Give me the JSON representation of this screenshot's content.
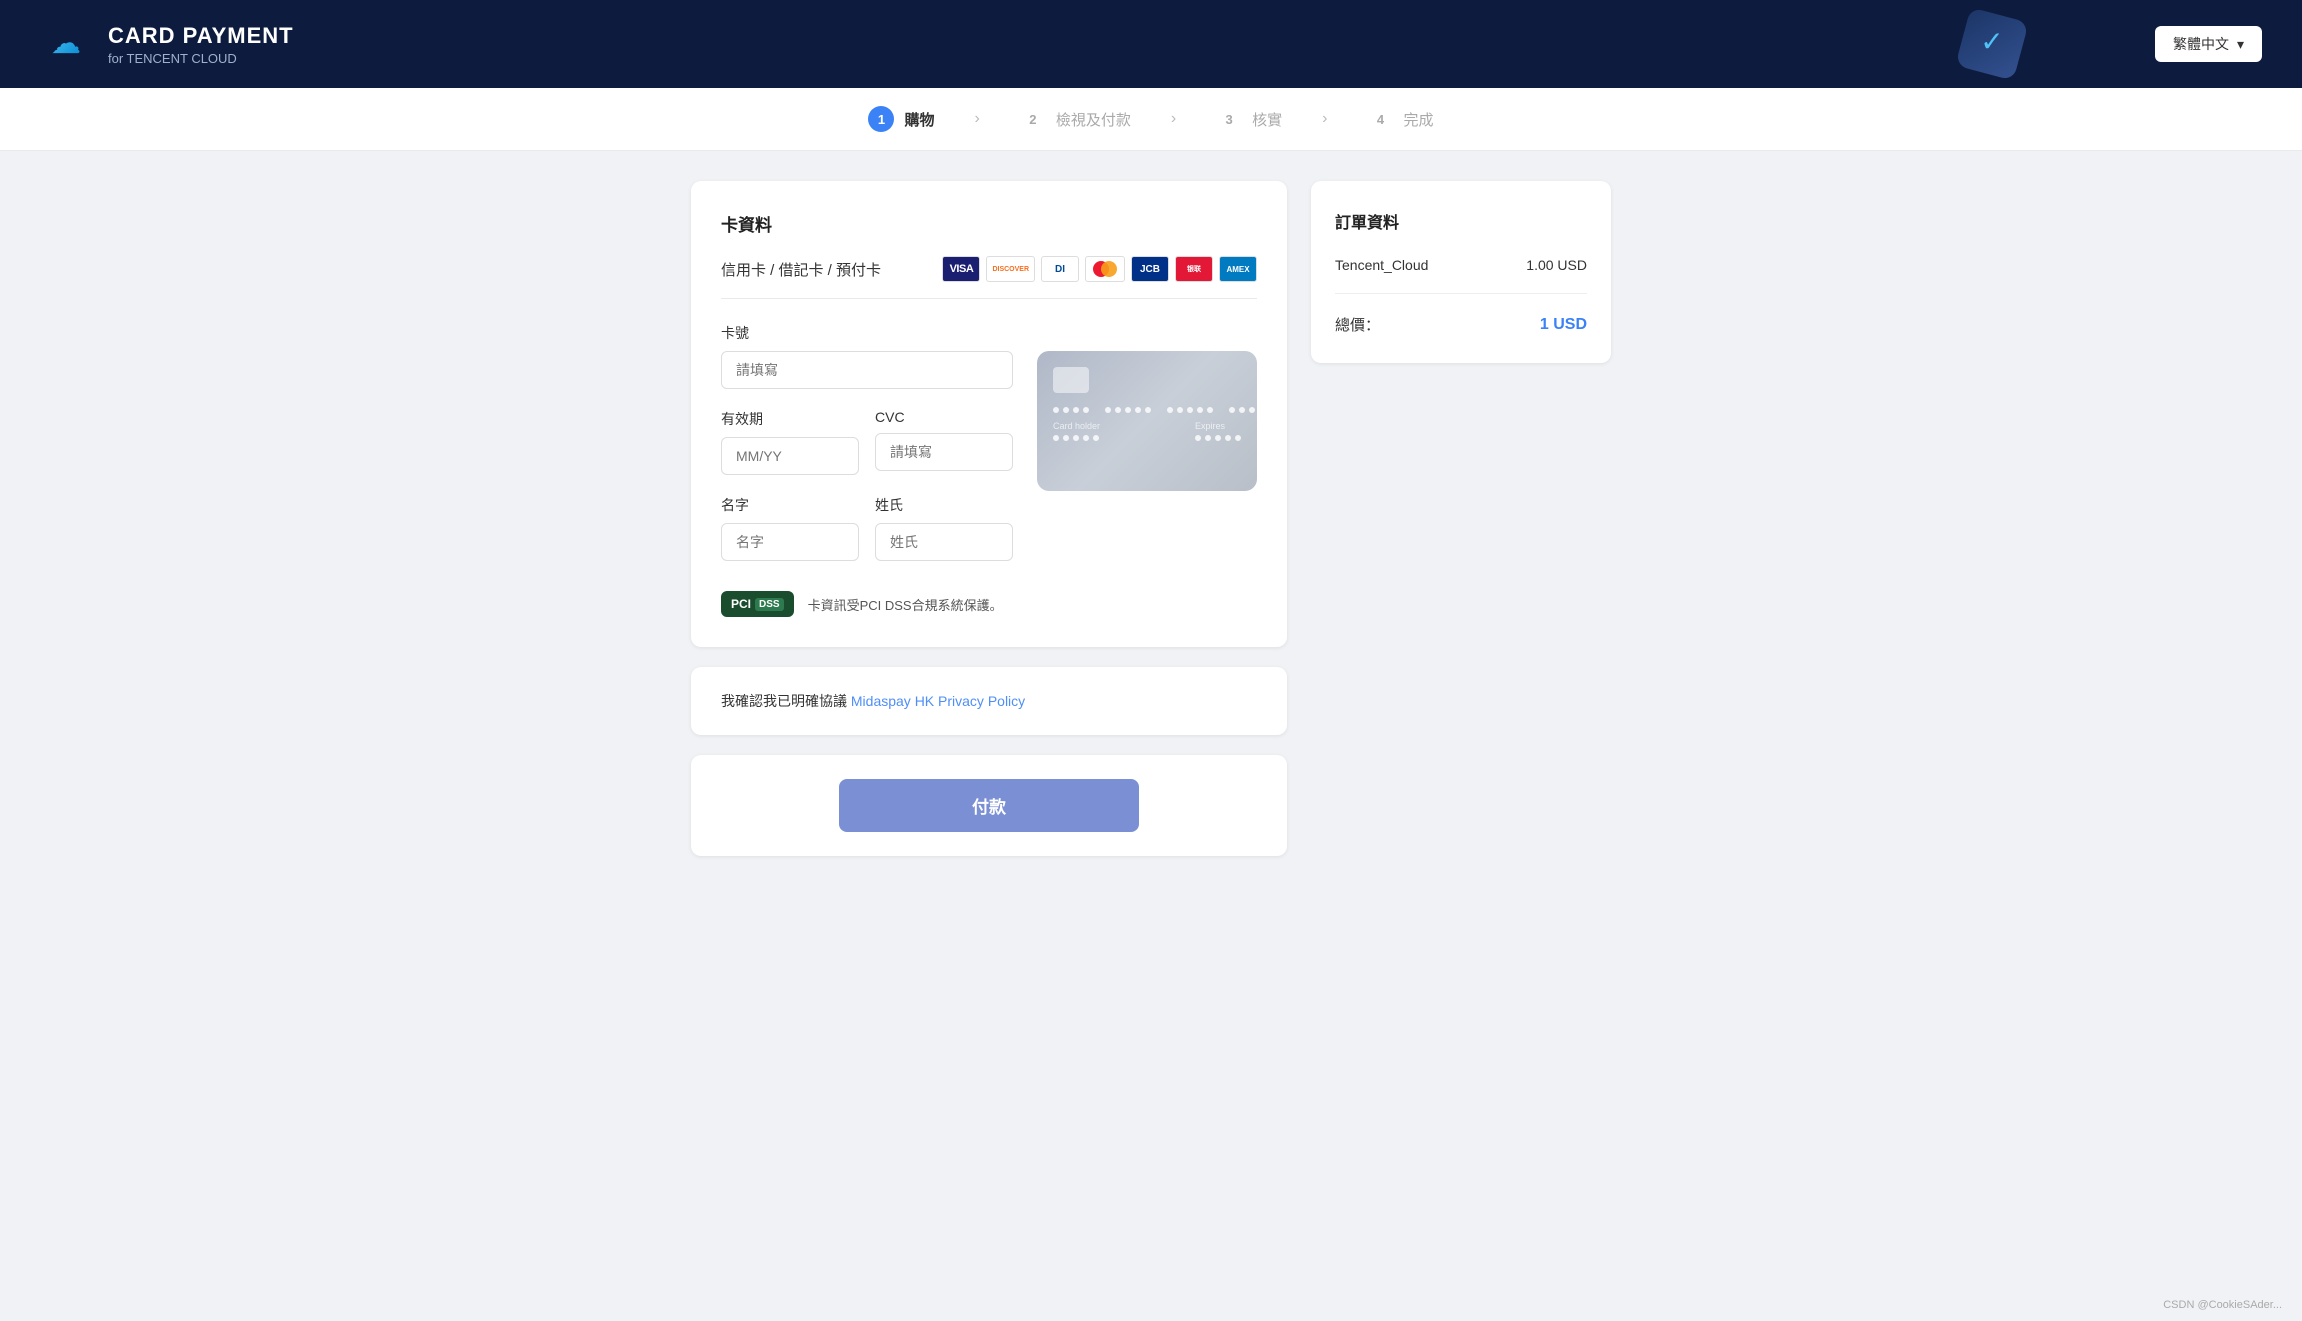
{
  "header": {
    "title": "CARD PAYMENT",
    "subtitle": "for TENCENT CLOUD",
    "lang_button": "繁體中文",
    "lang_arrow": "▾"
  },
  "stepper": {
    "steps": [
      {
        "id": 1,
        "label": "購物",
        "active": true
      },
      {
        "id": 2,
        "label": "檢視及付款",
        "active": false
      },
      {
        "id": 3,
        "label": "核實",
        "active": false
      },
      {
        "id": 4,
        "label": "完成",
        "active": false
      }
    ]
  },
  "card_form": {
    "section_title": "卡資料",
    "payment_method_label": "信用卡 / 借記卡 / 預付卡",
    "card_number_label": "卡號",
    "card_number_placeholder": "請填寫",
    "expiry_label": "有效期",
    "expiry_placeholder": "MM/YY",
    "cvc_label": "CVC",
    "cvc_placeholder": "請填寫",
    "first_name_label": "名字",
    "first_name_placeholder": "名字",
    "last_name_label": "姓氏",
    "last_name_placeholder": "姓氏",
    "card_visual": {
      "holder_label": "Card holder",
      "expiry_label": "Expires"
    },
    "pci_text": "卡資訊受PCI DSS合規系統保護。"
  },
  "privacy": {
    "text_before": "我確認我已明確協議",
    "link_text": "Midaspay HK Privacy Policy"
  },
  "pay": {
    "button_label": "付款"
  },
  "order": {
    "title": "訂單資料",
    "item_name": "Tencent_Cloud",
    "item_price": "1.00 USD",
    "total_label": "總價：",
    "total_price": "1 USD"
  },
  "footer": {
    "watermark": "CSDN @CookieSAder..."
  },
  "card_logos": [
    {
      "name": "VISA",
      "class": "visa"
    },
    {
      "name": "DISCOVER",
      "class": "discover"
    },
    {
      "name": "DI",
      "class": "diners"
    },
    {
      "name": "●●",
      "class": "mastercard"
    },
    {
      "name": "JCB",
      "class": "jcb"
    },
    {
      "name": "UP",
      "class": "unionpay"
    },
    {
      "name": "AMEX",
      "class": "amex"
    }
  ]
}
